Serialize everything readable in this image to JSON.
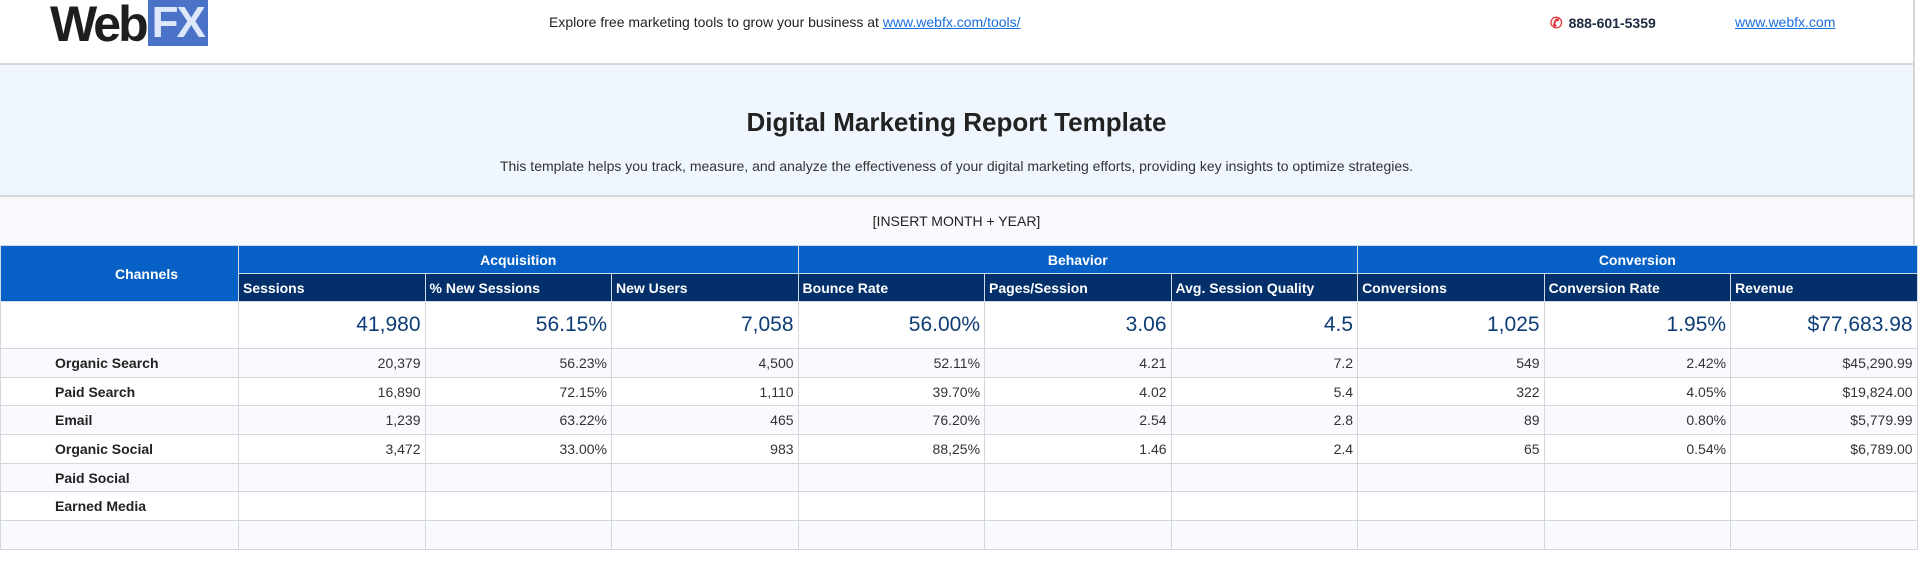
{
  "header": {
    "logo_web": "Web",
    "logo_fx": "FX",
    "tagline": "Explore free marketing tools to grow your business at ",
    "tagline_link": "www.webfx.com/tools/",
    "phone": "888-601-5359",
    "site": "www.webfx.com",
    "phone_icon": "phone-icon"
  },
  "title": "Digital Marketing Report Template",
  "subtitle": "This template helps you track, measure, and analyze the effectiveness of your digital marketing efforts, providing key insights to optimize strategies.",
  "period": "[INSERT MONTH + YEAR]",
  "table": {
    "channels_label": "Channels",
    "groups": [
      "Acquisition",
      "Behavior",
      "Conversion"
    ],
    "columns": [
      "Sessions",
      "% New Sessions",
      "New Users",
      "Bounce Rate",
      "Pages/Session",
      "Avg. Session Quality",
      "Conversions",
      "Conversion Rate",
      "Revenue"
    ],
    "totals": [
      "41,980",
      "56.15%",
      "7,058",
      "56.00%",
      "3.06",
      "4.5",
      "1,025",
      "1.95%",
      "$77,683.98"
    ],
    "rows": [
      {
        "name": "Organic Search",
        "values": [
          "20,379",
          "56.23%",
          "4,500",
          "52.11%",
          "4.21",
          "7.2",
          "549",
          "2.42%",
          "$45,290.99"
        ]
      },
      {
        "name": "Paid Search",
        "values": [
          "16,890",
          "72.15%",
          "1,110",
          "39.70%",
          "4.02",
          "5.4",
          "322",
          "4.05%",
          "$19,824.00"
        ]
      },
      {
        "name": "Email",
        "values": [
          "1,239",
          "63.22%",
          "465",
          "76.20%",
          "2.54",
          "2.8",
          "89",
          "0.80%",
          "$5,779.99"
        ]
      },
      {
        "name": "Organic Social",
        "values": [
          "3,472",
          "33.00%",
          "983",
          "88,25%",
          "1.46",
          "2.4",
          "65",
          "0.54%",
          "$6,789.00"
        ]
      },
      {
        "name": "Paid Social",
        "values": [
          "",
          "",
          "",
          "",
          "",
          "",
          "",
          "",
          ""
        ]
      },
      {
        "name": "Earned Media",
        "values": [
          "",
          "",
          "",
          "",
          "",
          "",
          "",
          "",
          ""
        ]
      },
      {
        "name": "",
        "values": [
          "",
          "",
          "",
          "",
          "",
          "",
          "",
          "",
          ""
        ]
      }
    ]
  }
}
